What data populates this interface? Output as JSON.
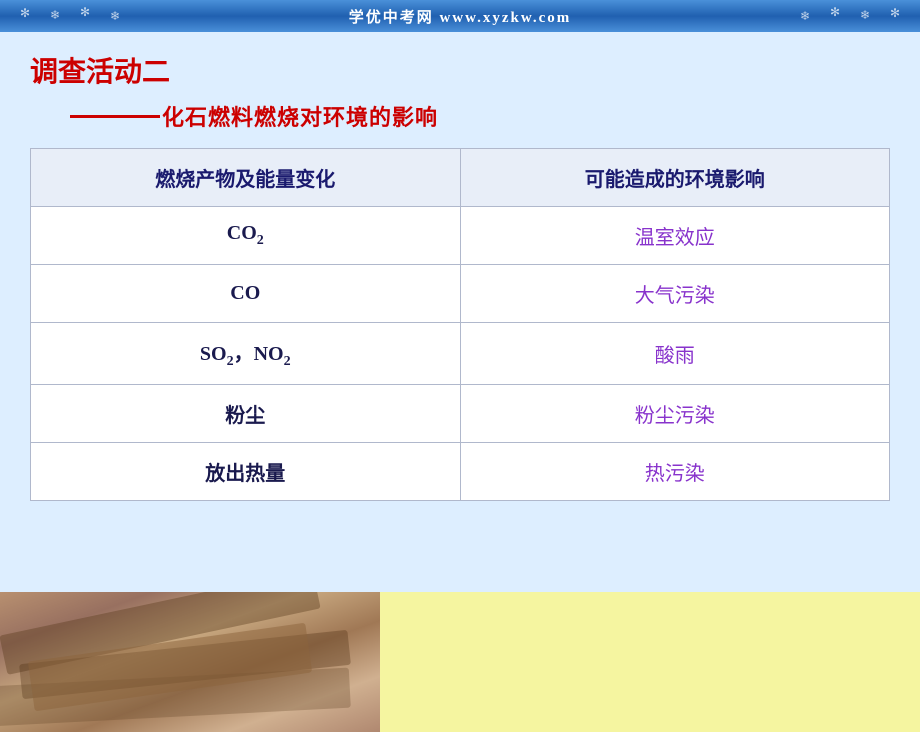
{
  "banner": {
    "text": "学优中考网  www.xyzkw.com"
  },
  "title": "调查活动二",
  "subtitle": {
    "line": "——",
    "text": "化石燃料燃烧对环境的影响"
  },
  "table": {
    "headers": [
      "燃烧产物及能量变化",
      "可能造成的环境影响"
    ],
    "rows": [
      {
        "left": "CO₂",
        "right": "温室效应",
        "left_raw": "CO2",
        "right_raw": "温室效应"
      },
      {
        "left": "CO",
        "right": "大气污染",
        "left_raw": "CO",
        "right_raw": "大气污染"
      },
      {
        "left": "SO₂，NO₂",
        "right": "酸雨",
        "left_raw": "SO2，NO2",
        "right_raw": "酸雨"
      },
      {
        "left": "粉尘",
        "right": "粉尘污染",
        "left_raw": "粉尘",
        "right_raw": "粉尘污染"
      },
      {
        "left": "放出热量",
        "right": "热污染",
        "left_raw": "放出热量",
        "right_raw": "热污染"
      }
    ]
  }
}
